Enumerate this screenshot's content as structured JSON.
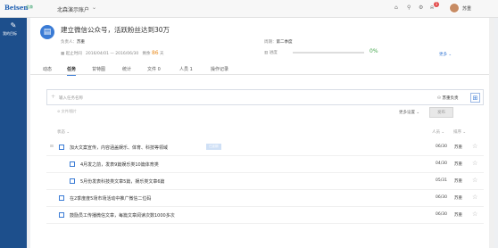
{
  "topbar": {
    "brand": "Beisen",
    "brand_sub": "北森",
    "account": "北森演示账户",
    "username": "苏重",
    "notification_count": "1"
  },
  "sidebar": {
    "item_label": "我的目标"
  },
  "goal": {
    "title": "建立微信公众号，活跃粉丝达到30万",
    "owner_label": "负责人：",
    "owner": "苏重",
    "period_label": "周期：",
    "period": "第二季度",
    "date_start_label": "起止时间",
    "date_range": "2016/04/01 — 2016/06/30",
    "remain_label": "剩余",
    "remain_days": "86",
    "remain_unit": "天",
    "progress_label": "进度",
    "progress_pct": "0%",
    "more_label": "更多"
  },
  "tabs": [
    {
      "label": "动态"
    },
    {
      "label": "任务"
    },
    {
      "label": "甘特图"
    },
    {
      "label": "统计"
    },
    {
      "label": "文件  0"
    },
    {
      "label": "人员  1"
    },
    {
      "label": "操作记录"
    }
  ],
  "task_input": {
    "placeholder": "输入任务名称",
    "owner": "苏重负责",
    "attach_label": "文件/图片",
    "more_settings": "更多设置",
    "publish": "发布"
  },
  "list_head": {
    "status": "状态",
    "people": "人员",
    "sort": "排序"
  },
  "tasks": [
    {
      "title": "加大文案宣传，内容涵盖娱乐、体育、科技等领域",
      "tag": "已延期",
      "date": "06/30",
      "owner": "苏重"
    },
    {
      "title": "4月发之前，发表9篇娱乐类10篇体育类",
      "date": "04/30",
      "owner": "苏重"
    },
    {
      "title": "5月份发表科技类文章5篇，娱乐类文章6篇",
      "date": "05/31",
      "owner": "苏重"
    },
    {
      "title": "在2季度度5场市场活动中推广微信二位码",
      "date": "06/30",
      "owner": "苏重"
    },
    {
      "title": "鼓励员工传播微信文章，每篇文章阅读次数1000多次",
      "date": "06/30",
      "owner": "苏重"
    }
  ]
}
